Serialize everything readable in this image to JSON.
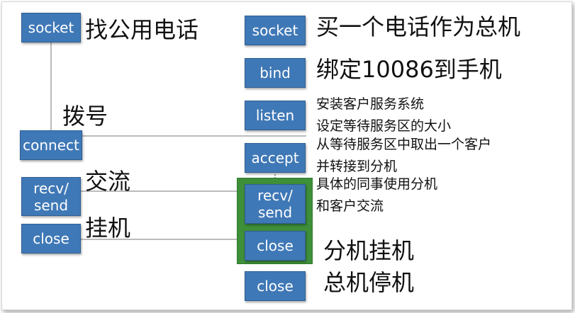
{
  "client": {
    "boxes": [
      "socket",
      "connect",
      "recv/\nsend",
      "close"
    ],
    "labels": {
      "socket": "找公用电话",
      "connect": "拨号",
      "recv_send": "交流",
      "close": "挂机"
    }
  },
  "server": {
    "boxes": [
      "socket",
      "bind",
      "listen",
      "accept",
      "recv/\nsend",
      "close",
      "close"
    ],
    "labels": {
      "socket": "买一个电话作为总机",
      "bind": "绑定10086到手机",
      "listen_1": "安装客户服务系统",
      "listen_2": "设定等待服务区的大小",
      "accept_1": "从等待服务区中取出一个客户",
      "accept_2": "并转接到分机",
      "recv_send_1": "具体的同事使用分机",
      "recv_send_2": "和客户交流",
      "close_ext": "分机挂机",
      "close_main": "总机停机"
    }
  },
  "colors": {
    "box": "#3f78b6",
    "box_text": "#ffffff",
    "highlight": "#3e8f3a",
    "line": "#555555"
  }
}
